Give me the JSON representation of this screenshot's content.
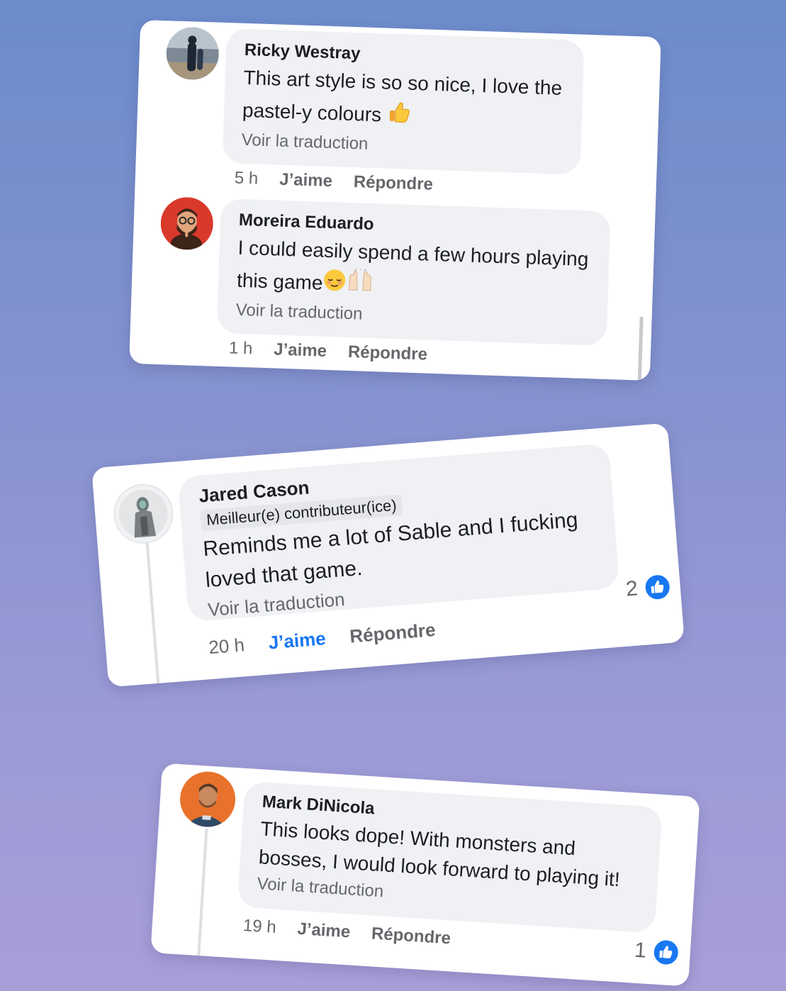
{
  "colors": {
    "accent": "#1877f2",
    "bubble": "#eff1f4",
    "muted_text": "#65676b",
    "text": "#1c1e21"
  },
  "card1": {
    "comments": [
      {
        "author": "Ricky Westray",
        "line1": "This art style is so so nice, I love the",
        "line2": "pastel-y colours",
        "emoji": "thumbs-up-icon",
        "translate": "Voir la traduction",
        "time": "5 h",
        "like": "J’aime",
        "reply": "Répondre"
      },
      {
        "author": "Moreira Eduardo",
        "line1": "I could easily spend a few hours playing",
        "line2": "this game",
        "emoji": "relieved-face-icon",
        "emoji2": "raising-hands-icon",
        "translate": "Voir la traduction",
        "time": "1 h",
        "like": "J’aime",
        "reply": "Répondre"
      }
    ]
  },
  "card2": {
    "author": "Jared Cason",
    "badge": "Meilleur(e) contributeur(ice)",
    "line1": "Reminds me a lot of Sable and I fucking",
    "line2": "loved that game.",
    "translate": "Voir la traduction",
    "time": "20 h",
    "like": "J’aime",
    "reply": "Répondre",
    "reaction_count": "2"
  },
  "card3": {
    "author": "Mark DiNicola",
    "line1": "This looks dope! With monsters and",
    "line2": "bosses, I would look forward to playing it!",
    "translate": "Voir la traduction",
    "time": "19 h",
    "like": "J’aime",
    "reply": "Répondre",
    "reaction_count": "1"
  }
}
